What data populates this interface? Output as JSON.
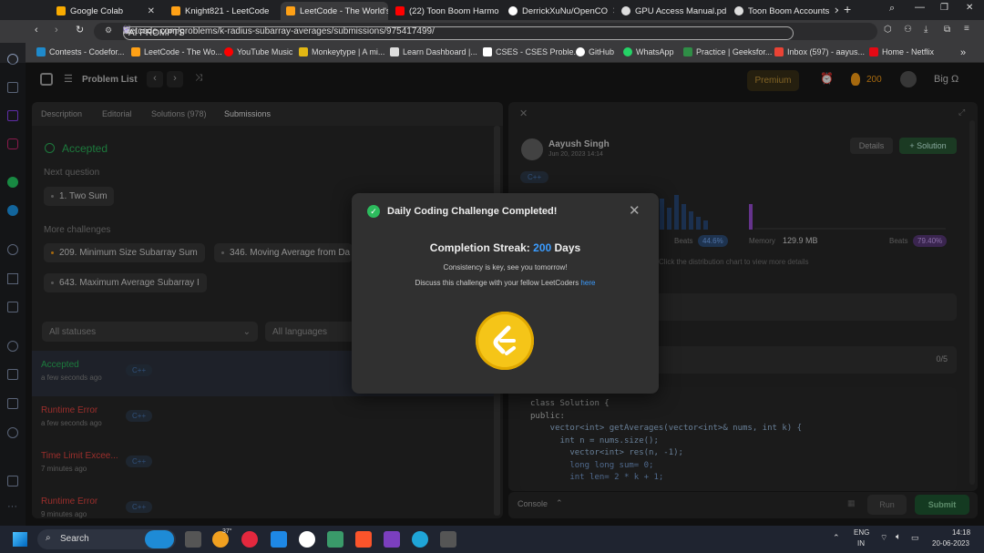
{
  "browser": {
    "tabs": [
      {
        "label": "Google Colab",
        "color": "#f9ab00"
      },
      {
        "label": "Knight821 - LeetCode",
        "color": "#ffa116"
      },
      {
        "label": "LeetCode - The World's",
        "color": "#ffa116"
      },
      {
        "label": "(22) Toon Boom Harmo",
        "color": "#ff0000"
      },
      {
        "label": "DerrickXuNu/OpenCO",
        "color": "#ffffff"
      },
      {
        "label": "GPU Access Manual.pd",
        "color": "#dddddd"
      },
      {
        "label": "Toon Boom Accounts",
        "color": "#dddddd"
      }
    ],
    "url": "leetcode.com/problems/k-radius-subarray-averages/submissions/975417499/",
    "ai_prompts": "AI PROMPTS",
    "bookmarks": [
      {
        "label": "Contests - Codefor...",
        "color": "#1f8acb"
      },
      {
        "label": "LeetCode - The Wo...",
        "color": "#ffa116"
      },
      {
        "label": "YouTube Music",
        "color": "#ff0000"
      },
      {
        "label": "Monkeytype | A mi...",
        "color": "#e2b714"
      },
      {
        "label": "Learn Dashboard |...",
        "color": "#ffffff"
      },
      {
        "label": "CSES - CSES Proble...",
        "color": "#ffffff"
      },
      {
        "label": "GitHub",
        "color": "#ffffff"
      },
      {
        "label": "WhatsApp",
        "color": "#25d366"
      },
      {
        "label": "Practice | Geeksfor...",
        "color": "#2f8d46"
      },
      {
        "label": "Inbox (597) - aayus...",
        "color": "#ea4335"
      },
      {
        "label": "Home - Netflix",
        "color": "#e50914"
      }
    ]
  },
  "header": {
    "problem_list": "Problem List",
    "premium": "Premium",
    "streak": "200",
    "username": "Big Ω"
  },
  "left": {
    "tabs": [
      "Description",
      "Editorial",
      "Solutions (978)",
      "Submissions"
    ],
    "accepted": "Accepted",
    "next_question_label": "Next question",
    "next_question": "1. Two Sum",
    "more_challenges_label": "More challenges",
    "challenges": [
      "209. Minimum Size Subarray Sum",
      "346. Moving Average from Da",
      "643. Maximum Average Subarray I"
    ],
    "filter_status": "All statuses",
    "filter_lang": "All languages",
    "submissions": [
      {
        "status": "Accepted",
        "time": "a few seconds ago",
        "lang": "C++",
        "color": "#2cbb5d"
      },
      {
        "status": "Runtime Error",
        "time": "a few seconds ago",
        "lang": "C++",
        "color": "#ef4743"
      },
      {
        "status": "Time Limit Excee...",
        "time": "7 minutes ago",
        "lang": "C++",
        "color": "#ef4743"
      },
      {
        "status": "Runtime Error",
        "time": "9 minutes ago",
        "lang": "C++",
        "color": "#ef4743"
      }
    ]
  },
  "right": {
    "user": "Aayush Singh",
    "date": "Jun 20, 2023 14:14",
    "details": "Details",
    "solution": "+ Solution",
    "lang": "C++",
    "beats_label": "Beats",
    "runtime_beats": "44.6%",
    "memory_label": "Memory",
    "memory": "129.9 MB",
    "memory_beats": "79.40%",
    "hint": "Click the distribution chart to view more details",
    "testcase_count": "0/5",
    "code": [
      "class Solution {",
      "public:",
      "    vector<int> getAverages(vector<int>& nums, int k) {",
      "      int n = nums.size();",
      "        vector<int> res(n, -1);",
      "        long long sum= 0;",
      "        int len= 2 * k + 1;"
    ],
    "console": "Console",
    "run": "Run",
    "submit": "Submit"
  },
  "modal": {
    "title": "Daily Coding Challenge Completed!",
    "streak_label": "Completion Streak:",
    "streak_value": "200",
    "streak_unit": "Days",
    "line1": "Consistency is key, see you tomorrow!",
    "line2": "Discuss this challenge with your fellow LeetCoders",
    "link": "here"
  },
  "taskbar": {
    "search": "Search",
    "weather": "37°",
    "lang": "ENG",
    "region": "IN",
    "time": "14:18",
    "date": "20-06-2023"
  }
}
